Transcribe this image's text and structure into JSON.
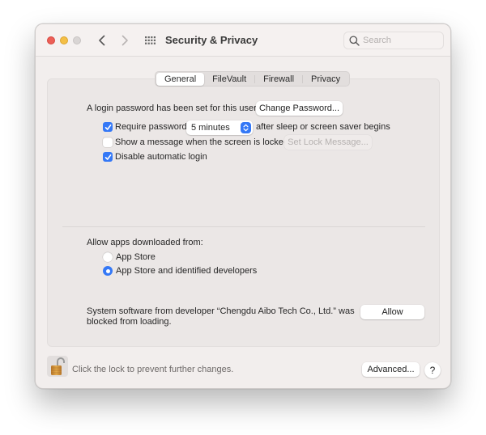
{
  "window": {
    "title": "Security & Privacy",
    "search": {
      "placeholder": "Search",
      "value": ""
    }
  },
  "tabs": [
    {
      "label": "General",
      "active": true
    },
    {
      "label": "FileVault",
      "active": false
    },
    {
      "label": "Firewall",
      "active": false
    },
    {
      "label": "Privacy",
      "active": false
    }
  ],
  "general": {
    "login_password_text": "A login password has been set for this user",
    "change_password_label": "Change Password...",
    "require_password": {
      "label": "Require password",
      "checked": true
    },
    "require_password_delay": {
      "value": "5 minutes"
    },
    "after_sleep_text": "after sleep or screen saver begins",
    "show_message": {
      "label": "Show a message when the screen is locked",
      "checked": false
    },
    "set_lock_message_label": "Set Lock Message...",
    "disable_auto_login": {
      "label": "Disable automatic login",
      "checked": true
    },
    "allow_apps_label": "Allow apps downloaded from:",
    "allow_options": [
      {
        "label": "App Store",
        "selected": false
      },
      {
        "label": "App Store and identified developers",
        "selected": true
      }
    ],
    "blocked_software_text_line1": "System software from developer “Chengdu Aibo Tech Co., Ltd.” was",
    "blocked_software_text_line2": "blocked from loading.",
    "allow_button_label": "Allow"
  },
  "footer": {
    "lock_text": "Click the lock to prevent further changes.",
    "advanced_label": "Advanced...",
    "help_label": "?"
  },
  "colors": {
    "accent": "#3478f6",
    "close": "#ec5f57",
    "minimize": "#f4bf46",
    "zoom_disabled": "#d9d5d4"
  }
}
